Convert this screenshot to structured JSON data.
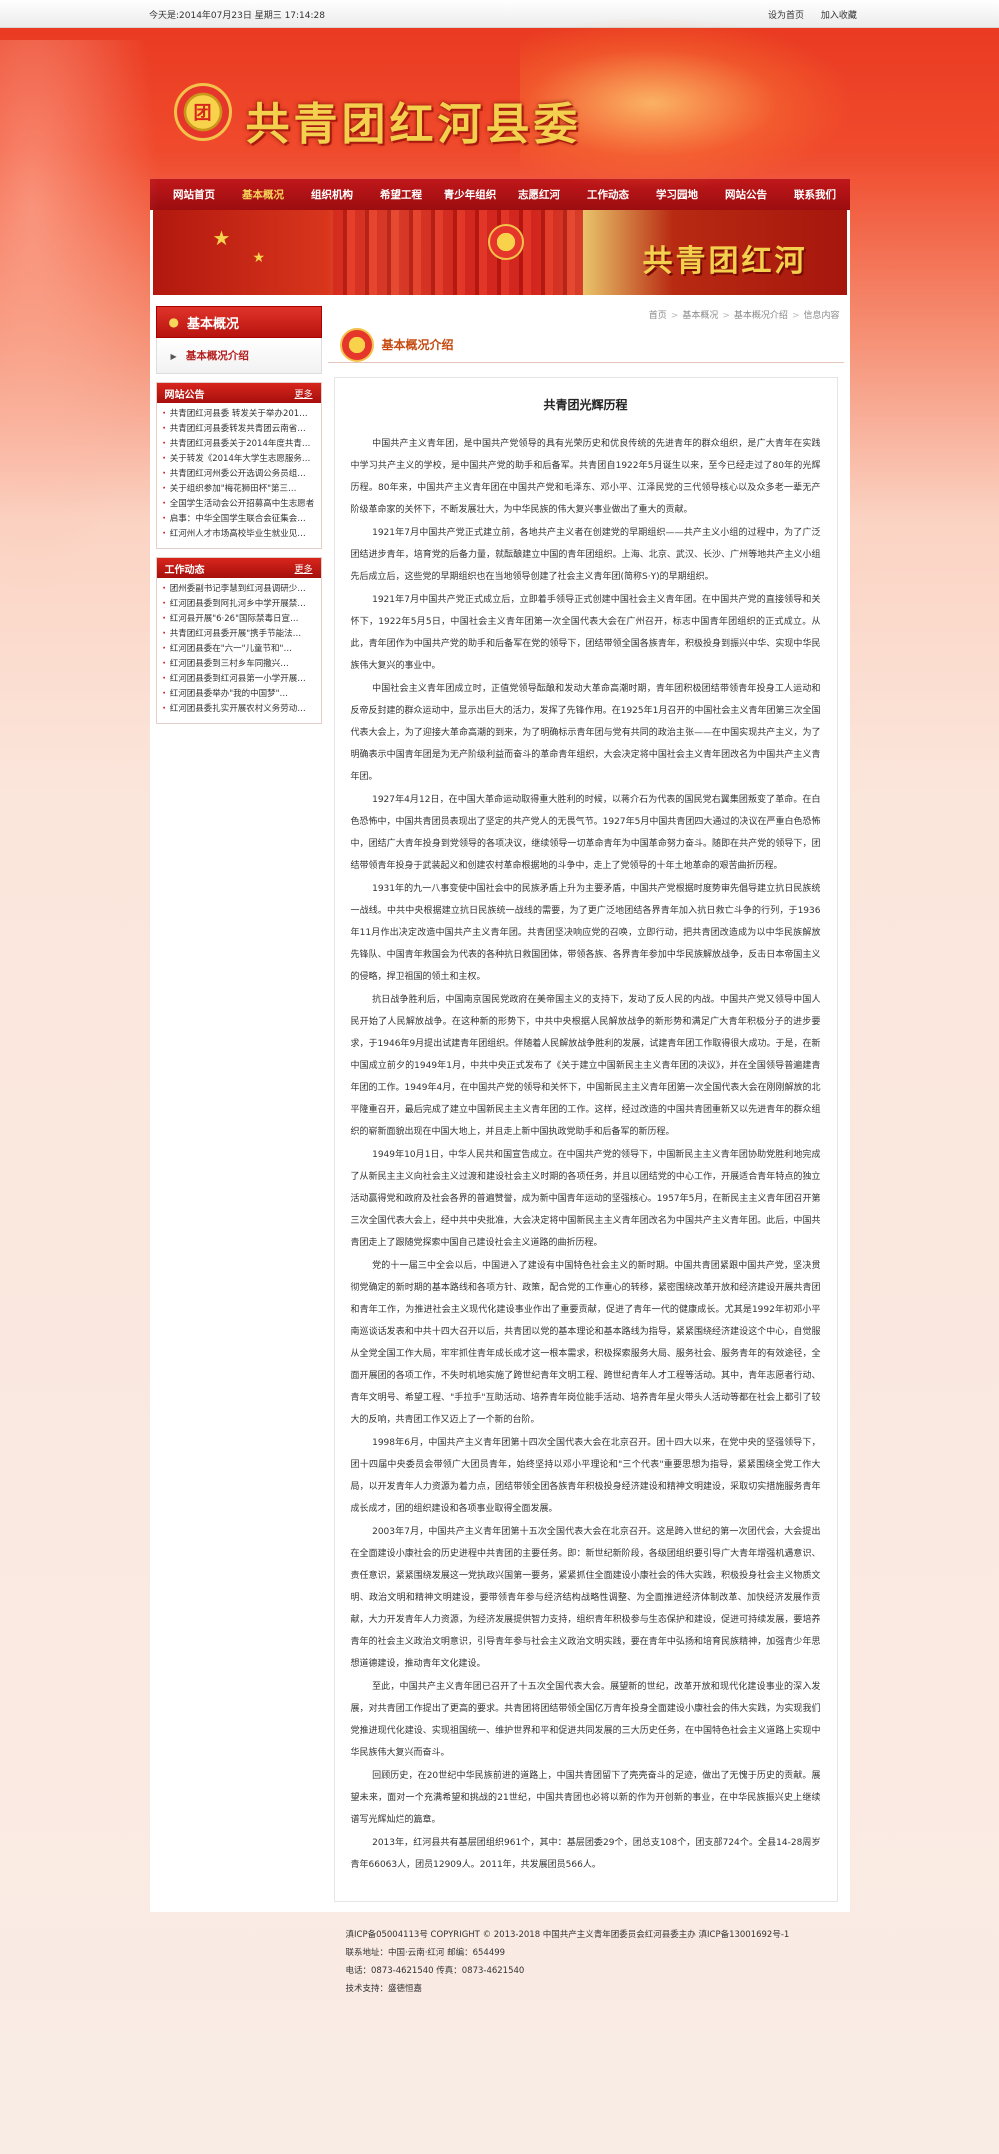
{
  "topbar": {
    "date": "今天是:2014年07月23日 星期三 17:14:28",
    "set_home": "设为首页",
    "add_fav": "加入收藏"
  },
  "header": {
    "title": "共青团红河县委",
    "emblem_char": "团"
  },
  "nav": {
    "items": [
      "网站首页",
      "基本概况",
      "组织机构",
      "希望工程",
      "青少年组织",
      "志愿红河",
      "工作动态",
      "学习园地",
      "网站公告",
      "联系我们"
    ],
    "active_index": 1
  },
  "banner": {
    "title": "共青团红河"
  },
  "sidebar": {
    "heading": "基本概况",
    "sub_link": "基本概况介绍",
    "notice": {
      "title": "网站公告",
      "more": "更多",
      "items": [
        "共青团红河县委 转发关于举办201…",
        "共青团红河县委转发共青团云南省…",
        "共青团红河县委关于2014年度共青…",
        "关于转发《2014年大学生志愿服务…",
        "共青团红河州委公开选调公务员组…",
        "关于组织参加\"梅花狮田杯\"第三…",
        "全国学生活动会公开招募高中生志愿者",
        "启事：中华全国学生联合会征集会…",
        "红河州人才市场高校毕业生就业见…"
      ]
    },
    "work": {
      "title": "工作动态",
      "more": "更多",
      "items": [
        "团州委副书记李慧到红河县调研少…",
        "红河团县委到阿扎河乡中学开展禁…",
        "红河县开展\"6·26\"国际禁毒日宣…",
        "共青团红河县委开展\"携手节能法…",
        "红河团县委在\"六一\"儿童节和\"…",
        "红河团县委到三村乡车同撒兴…",
        "红河团县委到红河县第一小学开展…",
        "红河团县委举办\"我的中国梦\"…",
        "红河团县委扎实开展农村义务劳动…"
      ]
    }
  },
  "main": {
    "breadcrumb": [
      "首页",
      "基本概况",
      "基本概况介绍",
      "信息内容"
    ],
    "section_title": "基本概况介绍",
    "article_title": "共青团光辉历程",
    "paragraphs": [
      "中国共产主义青年团，是中国共产党领导的具有光荣历史和优良传统的先进青年的群众组织，是广大青年在实践中学习共产主义的学校，是中国共产党的助手和后备军。共青团自1922年5月诞生以来，至今已经走过了80年的光辉历程。80年来，中国共产主义青年团在中国共产党和毛泽东、邓小平、江泽民党的三代领导核心以及众多老一辈无产阶级革命家的关怀下，不断发展壮大，为中华民族的伟大复兴事业做出了重大的贡献。",
      "1921年7月中国共产党正式建立前，各地共产主义者在创建党的早期组织——共产主义小组的过程中，为了广泛团结进步青年，培育党的后备力量，就酝酿建立中国的青年团组织。上海、北京、武汉、长沙、广州等地共产主义小组先后成立后，这些党的早期组织也在当地领导创建了社会主义青年团(简称S·Y)的早期组织。",
      "1921年7月中国共产党正式成立后，立即着手领导正式创建中国社会主义青年团。在中国共产党的直接领导和关怀下，1922年5月5日，中国社会主义青年团第一次全国代表大会在广州召开，标志中国青年团组织的正式成立。从此，青年团作为中国共产党的助手和后备军在党的领导下，团结带领全国各族青年，积极投身到振兴中华、实现中华民族伟大复兴的事业中。",
      "中国社会主义青年团成立时，正值党领导酝酿和发动大革命高潮时期，青年团积极团结带领青年投身工人运动和反帝反封建的群众运动中，显示出巨大的活力，发挥了先锋作用。在1925年1月召开的中国社会主义青年团第三次全国代表大会上，为了迎接大革命高潮的到来，为了明确标示青年团与党有共同的政治主张——在中国实现共产主义，为了明确表示中国青年团是为无产阶级利益而奋斗的革命青年组织，大会决定将中国社会主义青年团改名为中国共产主义青年团。",
      "1927年4月12日，在中国大革命运动取得重大胜利的时候，以蒋介石为代表的国民党右翼集团叛变了革命。在白色恐怖中，中国共青团员表现出了坚定的共产党人的无畏气节。1927年5月中国共青团四大通过的决议在严重白色恐怖中，团结广大青年投身到党领导的各项决议，继续领导一切革命青年为中国革命努力奋斗。随即在共产党的领导下，团结带领青年投身于武装起义和创建农村革命根据地的斗争中，走上了党领导的十年土地革命的艰苦曲折历程。",
      "1931年的九一八事变使中国社会中的民族矛盾上升为主要矛盾，中国共产党根据时度势审先倡导建立抗日民族统一战线。中共中央根据建立抗日民族统一战线的需要，为了更广泛地团结各界青年加入抗日救亡斗争的行列，于1936年11月作出决定改造中国共产主义青年团。共青团坚决响应党的召唤，立即行动，把共青团改造成为以中华民族解放先锋队、中国青年救国会为代表的各种抗日救国团体，带领各族、各界青年参加中华民族解放战争，反击日本帝国主义的侵略，捍卫祖国的领土和主权。",
      "抗日战争胜利后，中国南京国民党政府在美帝国主义的支持下，发动了反人民的内战。中国共产党又领导中国人民开始了人民解放战争。在这种新的形势下，中共中央根据人民解放战争的新形势和满足广大青年积极分子的进步要求，于1946年9月提出试建青年团组织。伴随着人民解放战争胜利的发展，试建青年团工作取得很大成功。于是，在新中国成立前夕的1949年1月，中共中央正式发布了《关于建立中国新民主主义青年团的决议》，并在全国领导普遍建青年团的工作。1949年4月，在中国共产党的领导和关怀下，中国新民主主义青年团第一次全国代表大会在刚刚解放的北平隆重召开，最后完成了建立中国新民主主义青年团的工作。这样，经过改造的中国共青团重新又以先进青年的群众组织的崭新面貌出现在中国大地上，并且走上新中国执政党助手和后备军的新历程。",
      "1949年10月1日，中华人民共和国宣告成立。在中国共产党的领导下，中国新民主主义青年团协助党胜利地完成了从新民主主义向社会主义过渡和建设社会主义时期的各项任务，并且以团结党的中心工作，开展适合青年特点的独立活动赢得党和政府及社会各界的普遍赞誉，成为新中国青年运动的坚强核心。1957年5月，在新民主主义青年团召开第三次全国代表大会上，经中共中央批准，大会决定将中国新民主主义青年团改名为中国共产主义青年团。此后，中国共青团走上了跟随党探索中国自己建设社会主义道路的曲折历程。",
      "党的十一届三中全会以后，中国进入了建设有中国特色社会主义的新时期。中国共青团紧跟中国共产党，坚决贯彻党确定的新时期的基本路线和各项方针、政策，配合党的工作重心的转移，紧密围绕改革开放和经济建设开展共青团和青年工作，为推进社会主义现代化建设事业作出了重要贡献，促进了青年一代的健康成长。尤其是1992年初邓小平南巡谈话发表和中共十四大召开以后，共青团以党的基本理论和基本路线为指导，紧紧围绕经济建设这个中心，自觉服从全党全国工作大局，牢牢抓住青年成长成才这一根本需求，积极探索服务大局、服务社会、服务青年的有效途径，全面开展团的各项工作，不失时机地实施了跨世纪青年文明工程、跨世纪青年人才工程等活动。其中，青年志愿者行动、青年文明号、希望工程、\"手拉手\"互助活动、培养青年岗位能手活动、培养青年星火带头人活动等都在社会上都引了较大的反响，共青团工作又迈上了一个新的台阶。",
      "1998年6月，中国共产主义青年团第十四次全国代表大会在北京召开。团十四大以来，在党中央的坚强领导下，团十四届中央委员会带领广大团员青年，始终坚持以邓小平理论和\"三个代表\"重要思想为指导，紧紧围绕全党工作大局，以开发青年人力资源为着力点，团结带领全团各族青年积极投身经济建设和精神文明建设，采取切实措施服务青年成长成才，团的组织建设和各项事业取得全面发展。",
      "2003年7月，中国共产主义青年团第十五次全国代表大会在北京召开。这是跨入世纪的第一次团代会，大会提出在全面建设小康社会的历史进程中共青团的主要任务。即：新世纪新阶段，各级团组织要引导广大青年增强机遇意识、责任意识，紧紧围绕发展这一党执政兴国第一要务，紧紧抓住全面建设小康社会的伟大实践，积极投身社会主义物质文明、政治文明和精神文明建设，要带领青年参与经济结构战略性调整、为全面推进经济体制改革、加快经济发展作贡献，大力开发青年人力资源，为经济发展提供智力支持，组织青年积极参与生态保护和建设，促进可持续发展，要培养青年的社会主义政治文明意识，引导青年参与社会主义政治文明实践，要在青年中弘扬和培育民族精神，加强青少年思想道德建设，推动青年文化建设。",
      "至此，中国共产主义青年团已召开了十五次全国代表大会。展望新的世纪，改革开放和现代化建设事业的深入发展，对共青团工作提出了更高的要求。共青团将团结带领全国亿万青年投身全面建设小康社会的伟大实践，为实现我们党推进现代化建设、实现祖国统一、维护世界和平和促进共同发展的三大历史任务，在中国特色社会主义道路上实现中华民族伟大复兴而奋斗。",
      "回顾历史，在20世纪中华民族前进的道路上，中国共青团留下了壳壳奋斗的足迹，做出了无愧于历史的贡献。展望未来，面对一个充满希望和挑战的21世纪，中国共青团也必将以新的作为开创新的事业，在中华民族振兴史上继续谱写光辉灿烂的篇章。",
      "2013年，红河县共有基层团组织961个，其中：基层团委29个，团总支108个，团支部724个。全县14-28周岁青年66063人，团员12909人。2011年，共发展团员566人。"
    ]
  },
  "footer": {
    "lines": [
      "滇ICP备05004113号 COPYRIGHT © 2013-2018 中国共产主义青年团委员会红河县委主办 滇ICP备13001692号-1",
      "联系地址：中国·云南·红河   邮编：654499",
      "电话：0873-4621540   传真：0873-4621540",
      "技术支持：盛德恒嘉"
    ]
  }
}
